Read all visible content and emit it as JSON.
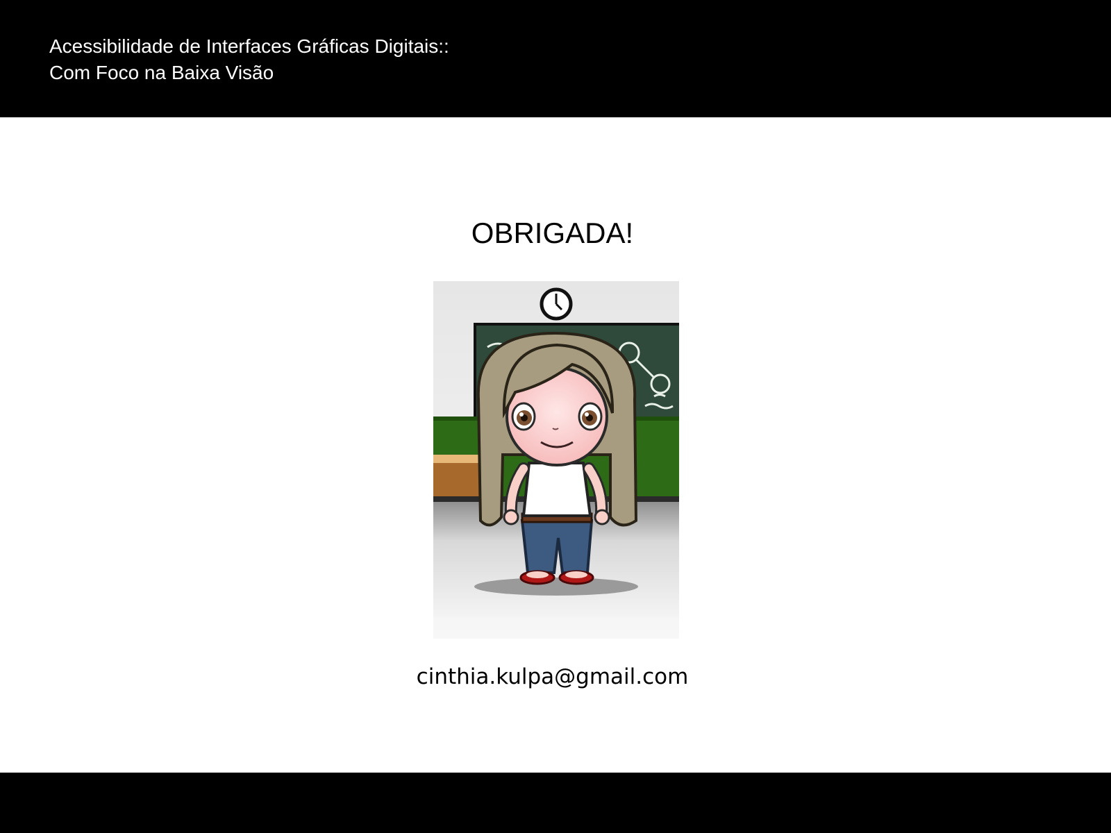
{
  "header": {
    "title_line1": "Acessibilidade de Interfaces Gráficas Digitais::",
    "title_line2": "Com Foco na Baixa Visão"
  },
  "slide": {
    "title": "OBRIGADA!",
    "email": "cinthia.kulpa@gmail.com"
  },
  "illustration": {
    "description_icon": "cartoon-girl-classroom-image"
  },
  "colors": {
    "bar": "#000000",
    "background": "#ffffff",
    "chalkboard": "#2f4a3a",
    "wall_green": "#2e6b16",
    "desk": "#a86a2c",
    "hair": "#a89c80",
    "jeans": "#3d5a80",
    "sandals": "#b01818"
  }
}
